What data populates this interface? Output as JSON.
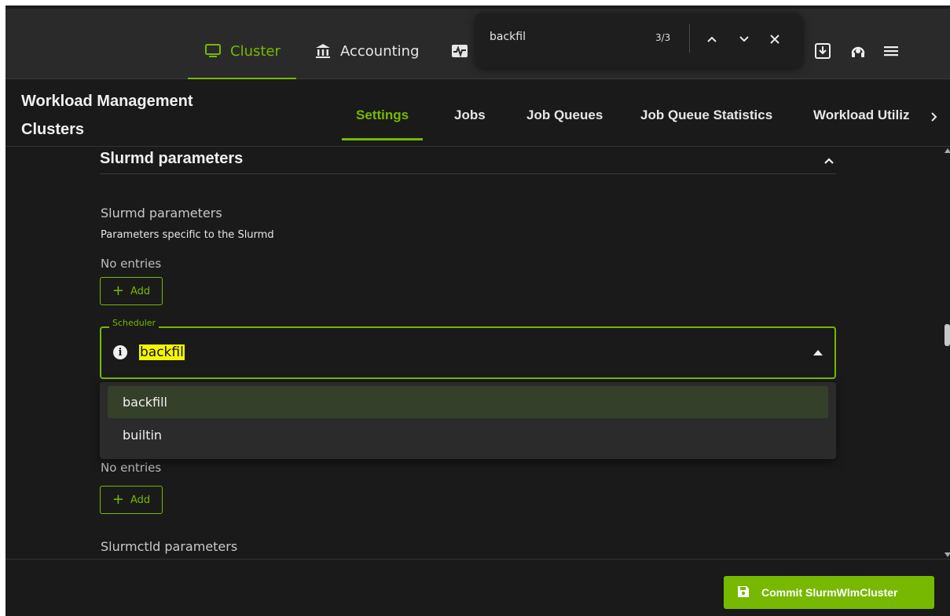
{
  "nav": {
    "items": [
      {
        "label": "Cluster",
        "icon": "monitor-icon",
        "active": true
      },
      {
        "label": "Accounting",
        "icon": "bank-icon"
      },
      {
        "label": "",
        "icon": "heartbeat-icon"
      }
    ],
    "right_icons": [
      "download-icon",
      "support-icon",
      "menu-icon"
    ],
    "accent": "#76b900"
  },
  "findbar": {
    "query": "backfil",
    "count": "3/3"
  },
  "header": {
    "title": "Workload Management Clusters",
    "tabs": [
      {
        "label": "Settings",
        "active": true
      },
      {
        "label": "Jobs"
      },
      {
        "label": "Job Queues"
      },
      {
        "label": "Job Queue Statistics"
      },
      {
        "label": "Workload Utiliz"
      }
    ]
  },
  "section": {
    "title": "Slurmd parameters",
    "field_title": "Slurmd parameters",
    "field_desc": "Parameters specific to the Slurmd",
    "no_entries": "No entries",
    "add_label": "Add",
    "scheduler": {
      "legend": "Scheduler",
      "value_highlight": "backfil",
      "options": [
        "backfill",
        "builtin"
      ],
      "highlighted_option": "backfill"
    },
    "no_entries_2": "No entries",
    "add_label_2": "Add",
    "next_field_title": "Slurmctld parameters"
  },
  "footer": {
    "commit_label": "Commit SlurmWlmCluster"
  }
}
